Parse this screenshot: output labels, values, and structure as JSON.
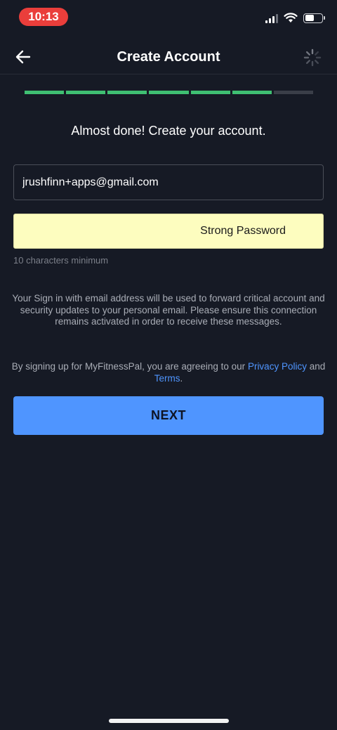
{
  "status_bar": {
    "time": "10:13",
    "icons": [
      "signal-icon",
      "wifi-icon",
      "battery-icon"
    ],
    "time_pill_color": "#ea3e3b"
  },
  "header": {
    "title": "Create Account",
    "back_icon": "arrow-left-icon",
    "spinner_icon": "loading-spinner-icon"
  },
  "progress": {
    "total_steps": 7,
    "completed_steps": 6,
    "done_color": "#3fbf72"
  },
  "form": {
    "heading": "Almost done! Create your account.",
    "email_value": "jrushfinn+apps@gmail.com",
    "password_strength": "Strong Password",
    "password_hint": "10 characters minimum"
  },
  "info_text": "Your Sign in with email address will be used to forward critical account and security updates to your personal email. Please ensure this connection remains activated in order to receive these messages.",
  "legal": {
    "prefix": "By signing up for MyFitnessPal, you are agreeing to our ",
    "privacy_link": "Privacy Policy",
    "conjunction": " and ",
    "terms_link": "Terms",
    "suffix": "."
  },
  "next_button": {
    "label": "NEXT",
    "color": "#4f95ff"
  }
}
